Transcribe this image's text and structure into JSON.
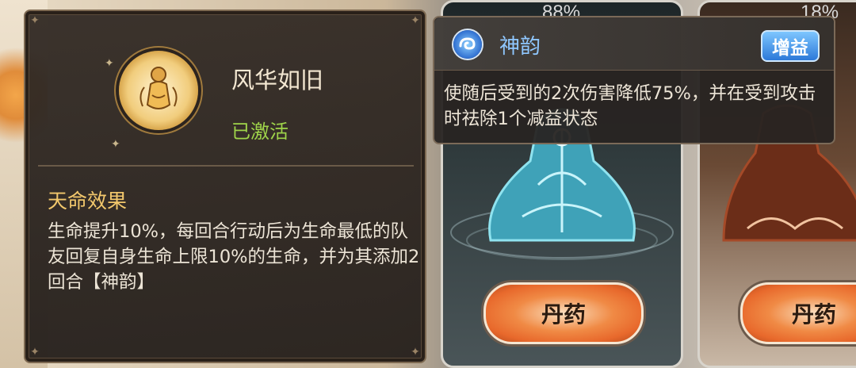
{
  "background": {
    "cards": [
      {
        "percent": "88%",
        "button_label": "丹药"
      },
      {
        "percent": "18%",
        "button_label": "丹药"
      }
    ]
  },
  "fate_panel": {
    "title": "风华如旧",
    "status": "已激活",
    "section_title": "天命效果",
    "description": "生命提升10%，每回合行动后为生命最低的队友回复自身生命上限10%的生命，并为其添加2回合【神韵】",
    "emblem_icon": "dancer-emblem-icon"
  },
  "buff_tooltip": {
    "name": "神韵",
    "badge": "增益",
    "description": "使随后受到的2次伤害降低75%，并在受到攻击时祛除1个减益状态",
    "icon": "swirl-cloud-icon"
  },
  "colors": {
    "status_active": "#9fd44a",
    "section_title": "#f3c86c",
    "buff_name": "#8fc7ff",
    "badge_bg": "#2c79d8",
    "button_orange": "#e8692c"
  }
}
